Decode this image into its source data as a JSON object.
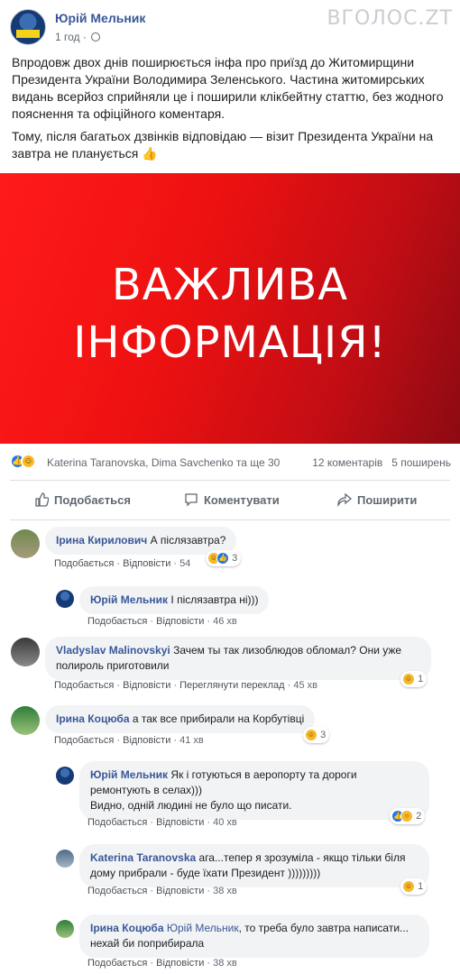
{
  "post": {
    "author": "Юрій Мельник",
    "time": "1 год",
    "watermark": "ВГОЛОС.ZT",
    "paragraph1": "Впродовж двох днів поширюється інфа про приїзд до Житомирщини Президента України Володимира Зеленського. Частина житомирських видань всерйоз сприйняли це і поширили клікбейтну статтю, без жодного пояснення та офіційного коментаря.",
    "paragraph2": "Тому, після багатьох дзвінків відповідаю — візит Президента України на завтра не планується",
    "banner_line1": "ВАЖЛИВА",
    "banner_line2": "ІНФОРМАЦІЯ!",
    "reacted_by": "Katerina Taranovska, Dima Savchenko та ще 30",
    "comments_count": "12 коментарів",
    "shares_count": "5 поширень"
  },
  "actions": {
    "like": "Подобається",
    "comment": "Коментувати",
    "share": "Поширити"
  },
  "comments": [
    {
      "name": "Ірина Кирилович",
      "text": "А післязавтра?",
      "like": "Подобається",
      "reply": "Відповісти",
      "time": "54",
      "reactions": "3"
    },
    {
      "name": "Юрій Мельник",
      "text": "І післязавтра ні)))",
      "like": "Подобається",
      "reply": "Відповісти",
      "time": "46 хв"
    },
    {
      "name": "Vladyslav Malinovskyi",
      "text": "Зачем ты так лизоблюдов обломал? Они уже полироль приготовили",
      "like": "Подобається",
      "reply": "Відповісти",
      "translate": "Переглянути переклад",
      "time": "45 хв",
      "reactions": "1"
    },
    {
      "name": "Ірина Коцюба",
      "text": "а так все прибирали на Корбутівці",
      "like": "Подобається",
      "reply": "Відповісти",
      "time": "41 хв",
      "reactions": "3"
    },
    {
      "name": "Юрій Мельник",
      "text": "Як і готуються в аеропорту та дороги ремонтують в селах)))",
      "text2": "Видно, одній людині не було що писати.",
      "like": "Подобається",
      "reply": "Відповісти",
      "time": "40 хв",
      "reactions": "2"
    },
    {
      "name": "Katerina Taranovska",
      "text": "ага...тепер я зрозуміла - якщо тільки біля дому прибрали - буде їхати Президент )))))))))",
      "like": "Подобається",
      "reply": "Відповісти",
      "time": "38 хв",
      "reactions": "1"
    },
    {
      "name": "Ірина Коцюба",
      "mention": "Юрій Мельник",
      "text": ", то треба було завтра написати... нехай би поприбирала",
      "like": "Подобається",
      "reply": "Відповісти",
      "time": "38 хв"
    }
  ],
  "colors": {
    "link": "#385898",
    "banner_red": "#ee1111",
    "banner_dark": "#8c0a12"
  }
}
